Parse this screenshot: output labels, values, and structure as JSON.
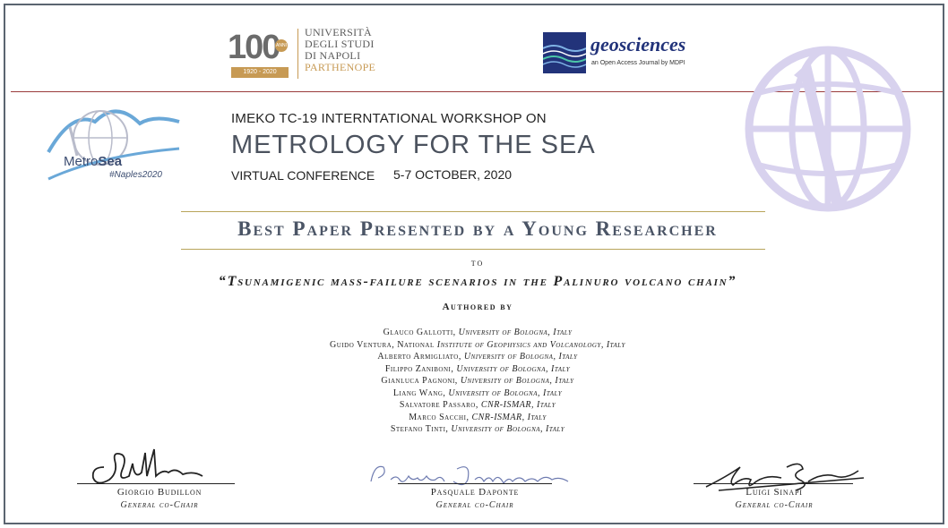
{
  "logos": {
    "unina": {
      "number": "100",
      "anni": "ANNI",
      "years": "1920 - 2020",
      "name_lines": [
        "UNIVERSITÀ",
        "DEGLI STUDI",
        "DI NAPOLI",
        "PARTHENOPE"
      ]
    },
    "geosciences": {
      "name": "geosciences",
      "tagline": "an Open Access Journal by MDPI"
    },
    "metrosea": {
      "name_light": "Metro",
      "name_bold": "Sea",
      "tag": "#Naples2020"
    }
  },
  "workshop": {
    "line1": "IMEKO TC-19 INTERNTATIONAL WORKSHOP ON",
    "title": "METROLOGY FOR THE SEA",
    "virtual": "VIRTUAL CONFERENCE",
    "dates": "5-7 OCTOBER, 2020"
  },
  "award": {
    "title": "Best Paper Presented by a Young Researcher",
    "to": "to",
    "paper_title": "“Tsunamigenic mass-failure scenarios in the Palinuro volcano chain”",
    "authored_by": "Authored by"
  },
  "authors": [
    {
      "name": "Glauco Gallotti, ",
      "aff": "University of Bologna, Italy"
    },
    {
      "name": "Guido Ventura, National ",
      "aff": "Institute of Geophysics and Volcanology, Italy"
    },
    {
      "name": "Alberto Armigliato, ",
      "aff": "University of Bologna, Italy"
    },
    {
      "name": "Filippo Zaniboni, ",
      "aff": "University of Bologna, Italy"
    },
    {
      "name": "Gianluca Pagnoni, ",
      "aff": "University of Bologna, Italy"
    },
    {
      "name": "Liang Wang, ",
      "aff": "University of Bologna, Italy"
    },
    {
      "name": "Salvatore Passaro, ",
      "aff": "CNR-ISMAR, Italy"
    },
    {
      "name": "Marco Sacchi, ",
      "aff": "CNR-ISMAR, Italy"
    },
    {
      "name": "Stefano Tinti, ",
      "aff": "University of Bologna, Italy"
    }
  ],
  "signatories": [
    {
      "name": "Giorgio Budillon",
      "role": "General co-Chair"
    },
    {
      "name": "Pasquale Daponte",
      "role": "General co-Chair"
    },
    {
      "name": "Luigi Sinapi",
      "role": "General co-Chair"
    }
  ],
  "colors": {
    "frame": "#5b6470",
    "rule_red": "#9a3b3b",
    "rule_gold": "#b8a45a",
    "unina_gold": "#c79a54",
    "mdpi_blue": "#22337a",
    "title_slate": "#4b5566",
    "watermark_lilac": "#d8d2ee"
  },
  "icons": [
    "globe-watermark-icon",
    "metrosea-globe-icon",
    "geosciences-waves-icon"
  ]
}
